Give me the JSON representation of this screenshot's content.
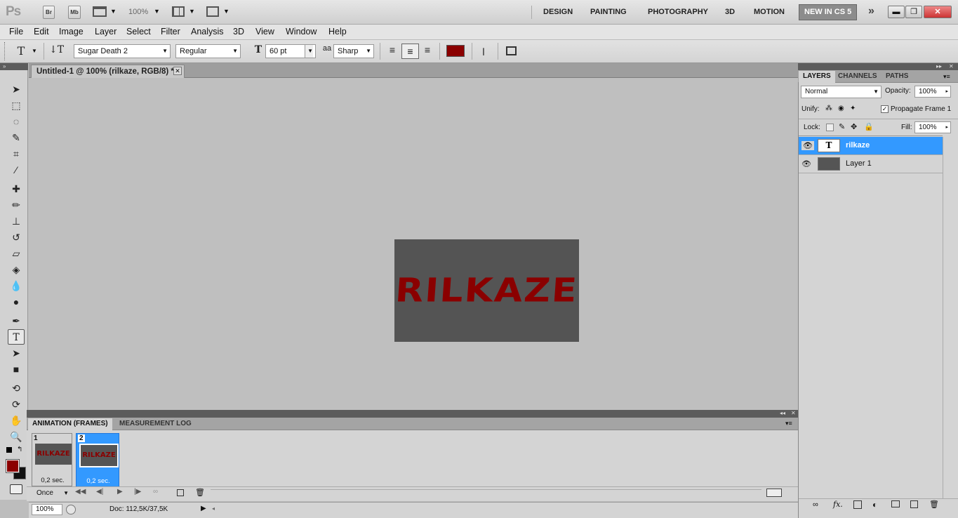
{
  "app": {
    "logo": "Ps",
    "bridge_label": "Br",
    "minibridge_label": "Mb",
    "zoom_value": "100%",
    "workspaces": [
      "DESIGN",
      "PAINTING",
      "PHOTOGRAPHY",
      "3D",
      "MOTION"
    ],
    "active_workspace": "NEW IN CS 5",
    "more_icon": "»",
    "window_controls": [
      "minimize-icon",
      "restore-icon",
      "close-icon"
    ]
  },
  "menu": [
    "File",
    "Edit",
    "Image",
    "Layer",
    "Select",
    "Filter",
    "Analysis",
    "3D",
    "View",
    "Window",
    "Help"
  ],
  "options": {
    "font_family": "Sugar Death 2",
    "font_style": "Regular",
    "font_size": "60 pt",
    "antialias_icon_text": "aa",
    "antialias": "Sharp",
    "text_color": "#8b0000"
  },
  "document": {
    "tab_title": "Untitled-1 @ 100% (rilkaze, RGB/8) *",
    "canvas_text": "RILKAZE",
    "canvas_bg": "#545454",
    "text_color": "#8a0000"
  },
  "tools": [
    "move-tool",
    "marquee-tool",
    "lasso-tool",
    "quick-select-tool",
    "crop-tool",
    "eyedropper-tool",
    "healing-brush-tool",
    "brush-tool",
    "clone-stamp-tool",
    "history-brush-tool",
    "eraser-tool",
    "paint-bucket-tool",
    "blur-tool",
    "dodge-tool",
    "pen-tool",
    "type-tool",
    "path-select-tool",
    "rectangle-tool",
    "3d-rotate-tool",
    "3d-orbit-tool",
    "hand-tool",
    "zoom-tool"
  ],
  "animation": {
    "tabs": [
      "ANIMATION (FRAMES)",
      "MEASUREMENT LOG"
    ],
    "frames": [
      {
        "num": "1",
        "thumb_text": "RILKAZE",
        "delay": "0,2 sec."
      },
      {
        "num": "2",
        "thumb_text": "RILKAZE",
        "delay": "0,2 sec."
      }
    ],
    "loop": "Once"
  },
  "status": {
    "zoom": "100%",
    "doc_info": "Doc: 112,5K/37,5K"
  },
  "layers_panel": {
    "tabs": [
      "LAYERS",
      "CHANNELS",
      "PATHS"
    ],
    "blend_mode": "Normal",
    "opacity_label": "Opacity:",
    "opacity": "100%",
    "unify_label": "Unify:",
    "propagate_label": "Propagate Frame 1",
    "lock_label": "Lock:",
    "fill_label": "Fill:",
    "fill": "100%",
    "layers": [
      {
        "name": "rilkaze",
        "selected": true,
        "thumb_text": "T"
      },
      {
        "name": "Layer 1",
        "selected": false,
        "thumb_text": ""
      }
    ]
  }
}
